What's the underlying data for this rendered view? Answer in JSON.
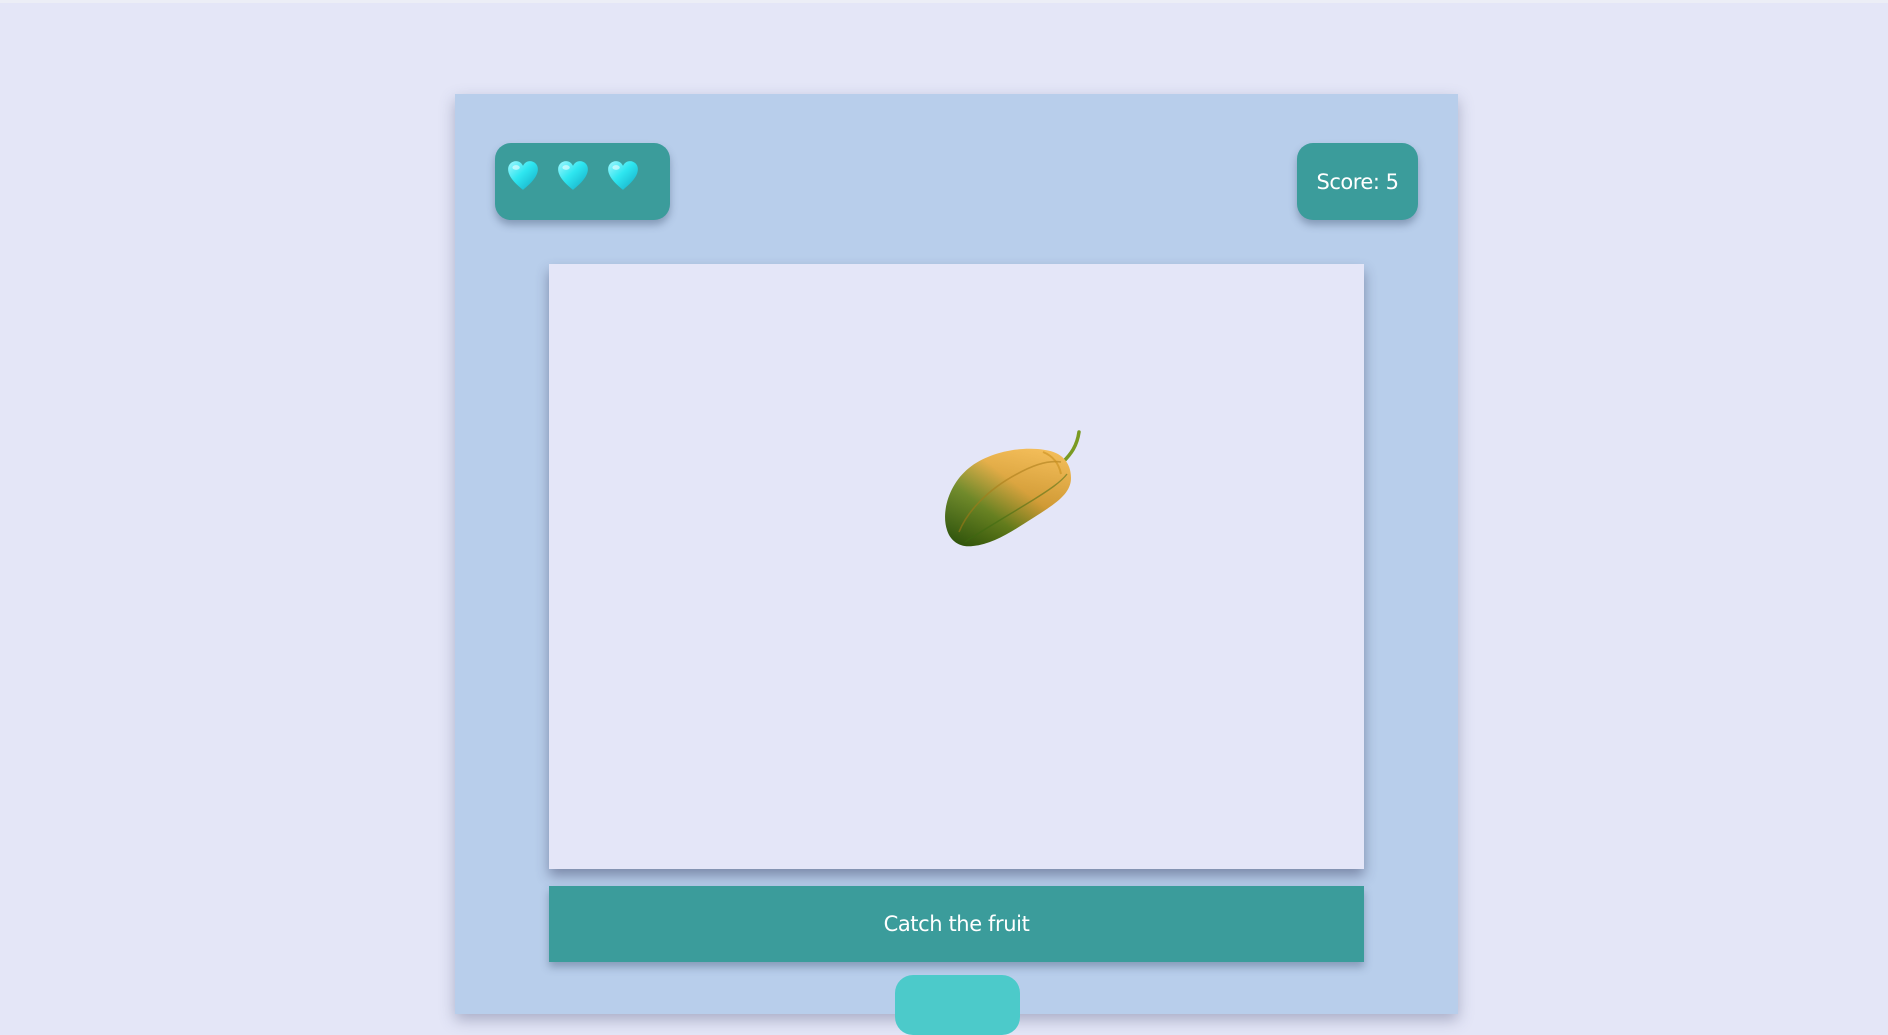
{
  "hud": {
    "lives": [
      {
        "icon": "cyan-heart-icon"
      },
      {
        "icon": "cyan-heart-icon"
      },
      {
        "icon": "cyan-heart-icon"
      }
    ],
    "score_text": "Score: 5"
  },
  "play_area": {
    "fruit": {
      "icon": "papaya-icon"
    }
  },
  "instruction": "Catch the fruit",
  "colors": {
    "page_background": "#e4e6f7",
    "panel_background": "#b8ceeb",
    "accent_teal": "#3b9c9b",
    "heart_cyan": "#2ee6f0",
    "button_cyan": "#4ccaca"
  }
}
